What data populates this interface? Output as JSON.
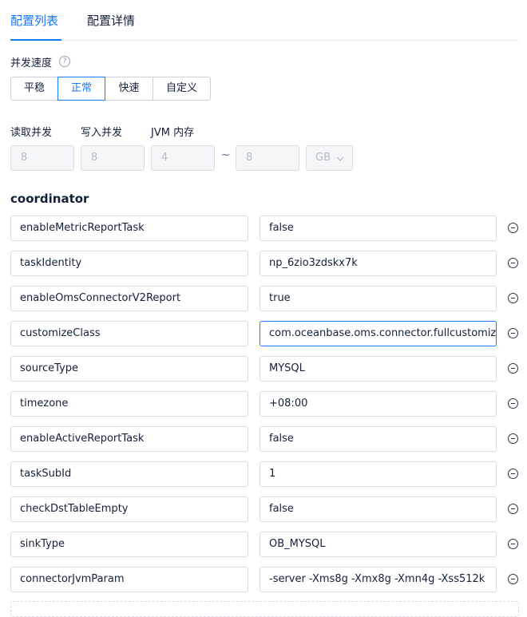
{
  "tabs": [
    {
      "label": "配置列表"
    },
    {
      "label": "配置详情"
    }
  ],
  "concurrency": {
    "label": "并发速度",
    "options": [
      "平稳",
      "正常",
      "快速",
      "自定义"
    ],
    "selected": "正常"
  },
  "fields": {
    "read_label": "读取并发",
    "write_label": "写入并发",
    "jvm_label": "JVM 内存",
    "read_value": "8",
    "write_value": "8",
    "jvm_min": "4",
    "jvm_max": "8",
    "tilde": "~",
    "unit": "GB"
  },
  "section": {
    "title": "coordinator"
  },
  "params": [
    {
      "key": "enableMetricReportTask",
      "value": "false"
    },
    {
      "key": "taskIdentity",
      "value": "np_6zio3zdskx7k"
    },
    {
      "key": "enableOmsConnectorV2Report",
      "value": "true"
    },
    {
      "key": "customizeClass",
      "value": "com.oceanbase.oms.connector.fullcustomize"
    },
    {
      "key": "sourceType",
      "value": "MYSQL"
    },
    {
      "key": "timezone",
      "value": "+08:00"
    },
    {
      "key": "enableActiveReportTask",
      "value": "false"
    },
    {
      "key": "taskSubId",
      "value": "1"
    },
    {
      "key": "checkDstTableEmpty",
      "value": "false"
    },
    {
      "key": "sinkType",
      "value": "OB_MYSQL"
    },
    {
      "key": "connectorJvmParam",
      "value": "-server -Xms8g -Xmx8g -Xmn4g -Xss512k"
    }
  ]
}
